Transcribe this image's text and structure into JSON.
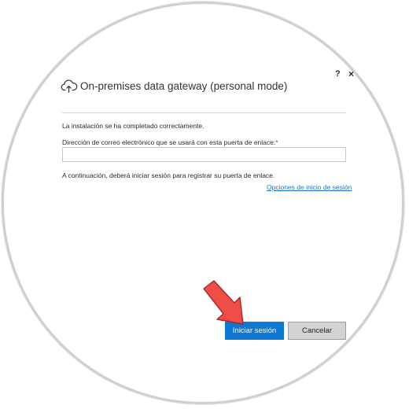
{
  "window": {
    "title": "On-premises data gateway (personal mode)",
    "help_label": "?",
    "close_label": "×"
  },
  "content": {
    "status_message": "La instalación se ha completado correctamente.",
    "email_label": "Dirección de correo electrónico que se usará con esta puerta de enlace:",
    "required_marker": "*",
    "email_value": "",
    "email_placeholder": "",
    "info_message": "A continuación, deberá iniciar sesión para registrar su puerta de enlace.",
    "options_link": "Opciones de inicio de sesión"
  },
  "buttons": {
    "sign_in": "Iniciar sesión",
    "cancel": "Cancelar"
  },
  "colors": {
    "primary": "#0f78d4",
    "link": "#1e6fd0",
    "arrow": "#f04c48"
  },
  "icons": {
    "title": "cloud-upload-icon",
    "pointer": "arrow-pointer-icon"
  }
}
